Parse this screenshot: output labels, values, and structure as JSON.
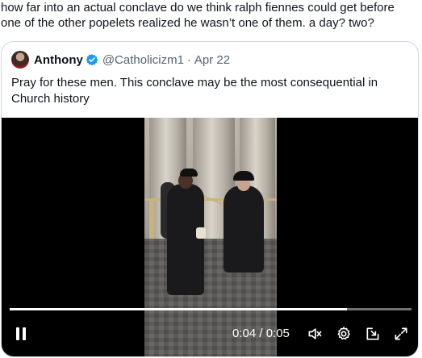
{
  "post": {
    "text": "how far into an actual conclave do we think ralph fiennes could get before one of the other popelets realized he wasn’t one of them. a day? two?"
  },
  "quoted_post": {
    "display_name": "Anthony",
    "handle": "@Catholicizm1",
    "separator": "·",
    "date": "Apr 22",
    "text": "Pray for these men. This conclave may be the most consequential in Church history",
    "verified_color": "#1d9bf0"
  },
  "video": {
    "time_label": "0:04 / 0:05",
    "progress": 0.84,
    "icons": [
      "pause-icon",
      "mute-icon",
      "settings-icon",
      "download-icon",
      "fullscreen-icon"
    ]
  }
}
